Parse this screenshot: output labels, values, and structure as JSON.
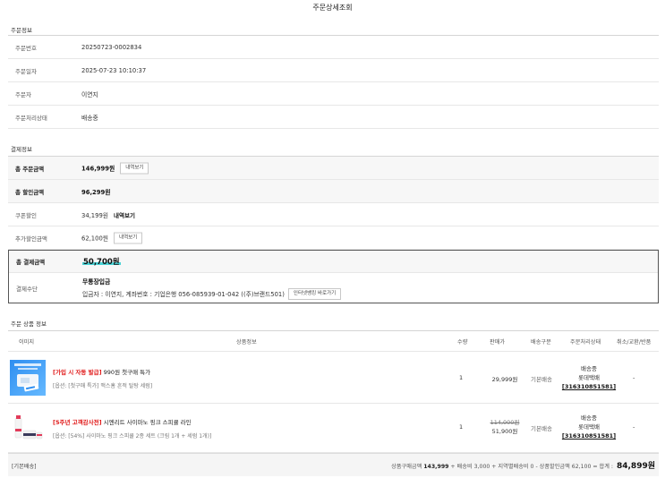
{
  "page_title": "주문상세조회",
  "order_info": {
    "section_title": "주문정보",
    "rows": [
      {
        "label": "주문번호",
        "value": "20250723-0002834"
      },
      {
        "label": "주문일자",
        "value": "2025-07-23 10:10:37"
      },
      {
        "label": "주문자",
        "value": "이연지"
      },
      {
        "label": "주문처리상태",
        "value": "배송중"
      }
    ]
  },
  "payment_info": {
    "section_title": "결제정보",
    "total_order": {
      "label": "총 주문금액",
      "value": "146,999원",
      "button": "내역보기"
    },
    "total_discount": {
      "label": "총 할인금액",
      "value": "96,299원"
    },
    "coupon": {
      "label": "쿠폰할인",
      "value": "34,199원",
      "link": "내역보기"
    },
    "extra_discount": {
      "label": "추가할인금액",
      "value": "62,100원",
      "button": "내역보기"
    },
    "total_paid": {
      "label": "총 결제금액",
      "value": "50,700원"
    },
    "method": {
      "label": "결제수단",
      "type": "무통장입금",
      "detail": "입금자 : 이연지, 계좌번호 : 기업은행 056-085939-01-042 ((주)브랜드501)",
      "button": "인터넷뱅킹 바로가기"
    }
  },
  "products": {
    "section_title": "주문 상품 정보",
    "headers": {
      "image": "이미지",
      "info": "상품정보",
      "qty": "수량",
      "price": "판매가",
      "shipping_type": "배송구분",
      "status": "주문처리상태",
      "cancel": "취소/교환/반품"
    },
    "items": [
      {
        "tag": "[가입 시 자동 발급]",
        "name": " 990원 첫구매 특가",
        "option": "[옵션: [첫구매 특가] 맥스홈 흔적 탈탕 세럼]",
        "qty": "1",
        "original_price": "",
        "price": "29,999원",
        "shipping_type": "기본배송",
        "status": "배송중",
        "courier": "롯데택배",
        "tracking": "[316310851581]",
        "cancel": "-"
      },
      {
        "tag": "[5주년 고객감사전]",
        "name": " 시엔리트 사이마노 핑크 스피큘 라인",
        "option": "[옵션: [54%] 사이마노 핑크 스피큘 2종 세트 (크림 1개 + 세럼 1개)]",
        "qty": "1",
        "original_price": "114,000원",
        "price": "51,900원",
        "shipping_type": "기본배송",
        "status": "배송중",
        "courier": "롯데택배",
        "tracking": "[316310851581]",
        "cancel": "-"
      }
    ]
  },
  "footer": {
    "label": "[기본배송]",
    "summary_prefix": "상품구매금액",
    "product_total": "143,999",
    "summary_mid": "+ 배송비 3,000 + 지역별배송비 0 - 상품할인금액 62,100 = 합계 :",
    "grand_total": "84,899원"
  },
  "colors": {
    "highlight": "#49d3d6",
    "tag_red": "#e01919"
  }
}
